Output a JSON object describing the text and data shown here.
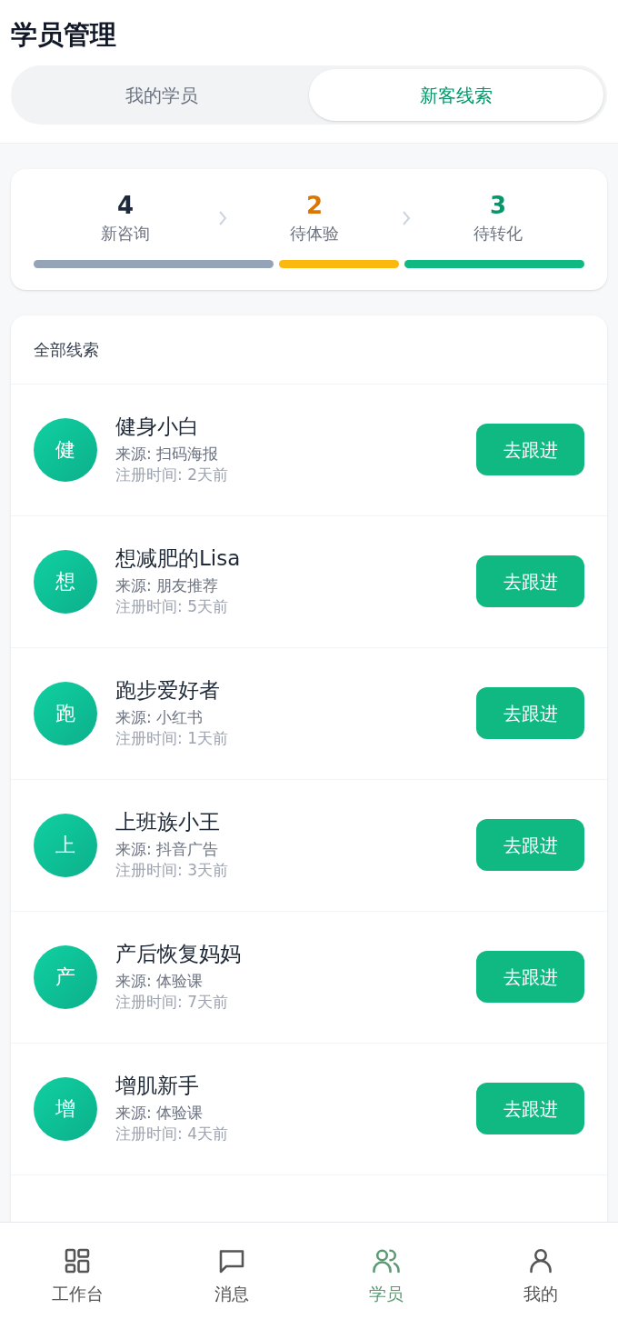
{
  "title": "学员管理",
  "tabs": [
    {
      "label": "我的学员",
      "selected": false
    },
    {
      "label": "新客线索",
      "selected": true
    }
  ],
  "funnel": [
    {
      "kind": "new",
      "count": "4",
      "label": "新咨询",
      "color": "#94a3b8"
    },
    {
      "kind": "trial",
      "count": "2",
      "label": "待体验",
      "color": "#fbb80f"
    },
    {
      "kind": "convert",
      "count": "3",
      "label": "待转化",
      "color": "#10b981"
    }
  ],
  "list": {
    "title": "全部线索",
    "leads": [
      {
        "initial": "健",
        "name": "健身小白",
        "source": "来源: 扫码海报",
        "registered": "注册时间: 2天前",
        "action": "去跟进"
      },
      {
        "initial": "想",
        "name": "想减肥的Lisa",
        "source": "来源: 朋友推荐",
        "registered": "注册时间: 5天前",
        "action": "去跟进"
      },
      {
        "initial": "跑",
        "name": "跑步爱好者",
        "source": "来源: 小红书",
        "registered": "注册时间: 1天前",
        "action": "去跟进"
      },
      {
        "initial": "上",
        "name": "上班族小王",
        "source": "来源: 抖音广告",
        "registered": "注册时间: 3天前",
        "action": "去跟进"
      },
      {
        "initial": "产",
        "name": "产后恢复妈妈",
        "source": "来源: 体验课",
        "registered": "注册时间: 7天前",
        "action": "去跟进"
      },
      {
        "initial": "增",
        "name": "增肌新手",
        "source": "来源: 体验课",
        "registered": "注册时间: 4天前",
        "action": "去跟进"
      }
    ]
  },
  "nav": [
    {
      "kind": "grid",
      "label": "工作台",
      "selected": false
    },
    {
      "kind": "chat",
      "label": "消息",
      "selected": false
    },
    {
      "kind": "users",
      "label": "学员",
      "selected": true
    },
    {
      "kind": "user",
      "label": "我的",
      "selected": false
    }
  ]
}
